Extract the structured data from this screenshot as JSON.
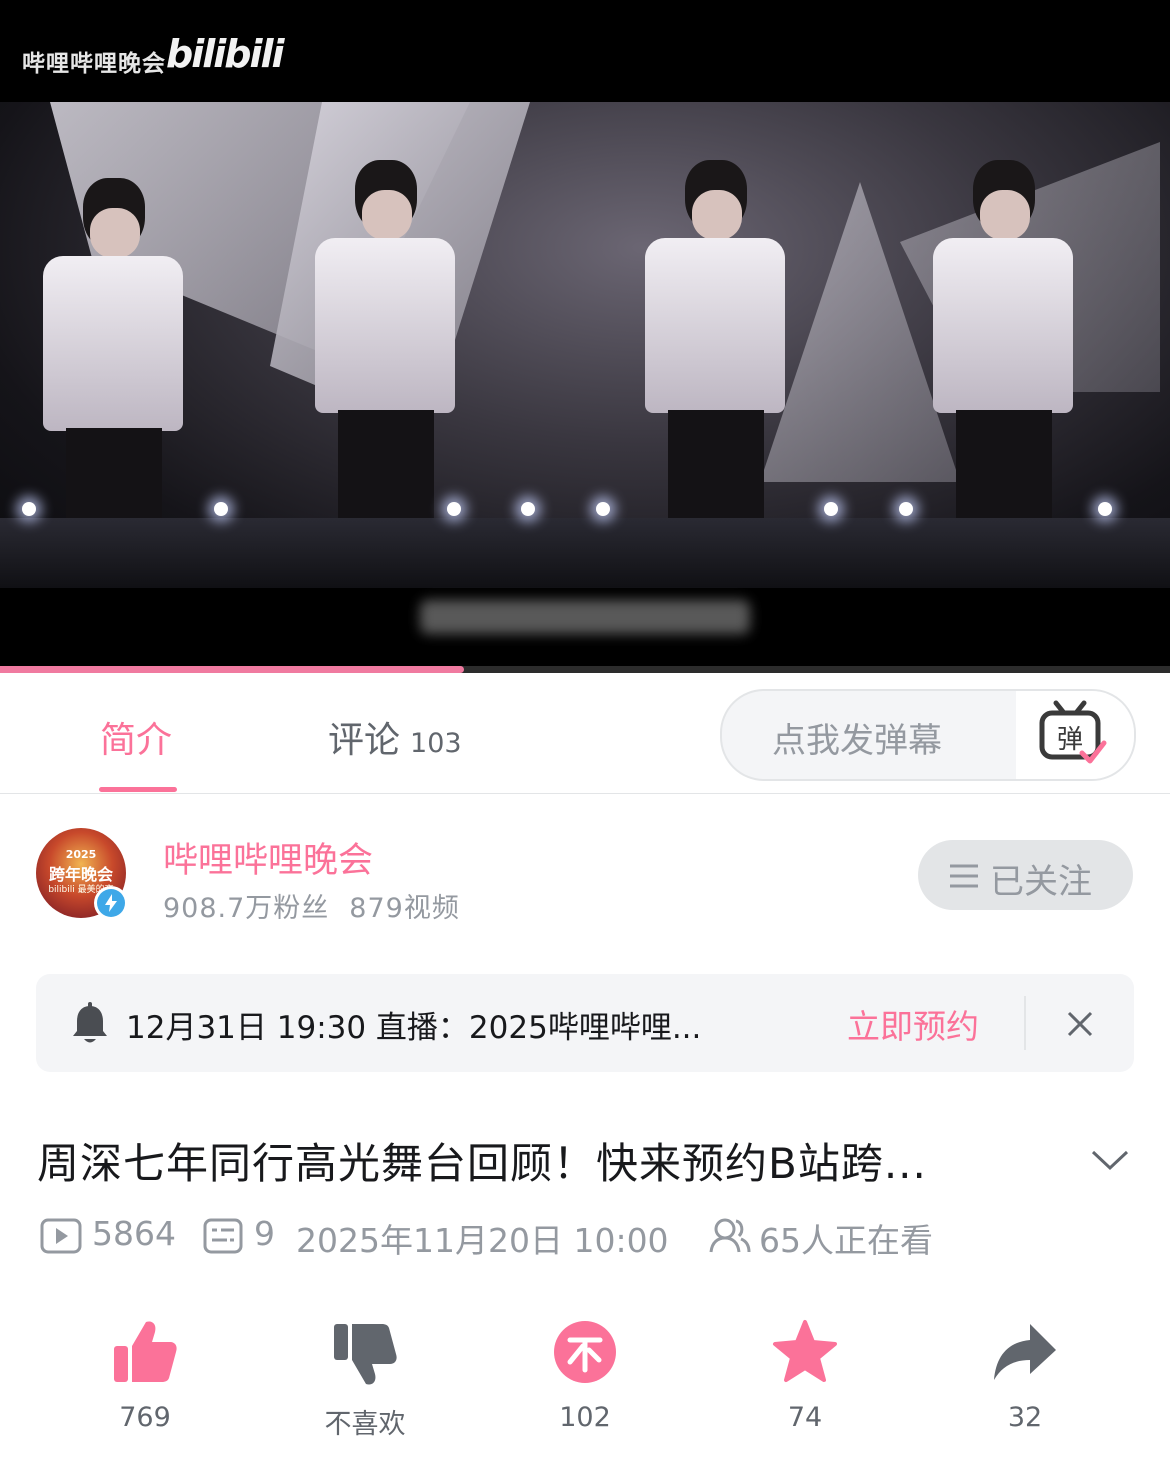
{
  "video": {
    "watermark": "哔哩哔哩晚会",
    "logo": "bilibili",
    "progress_fraction": 0.397
  },
  "tabs": {
    "intro": "简介",
    "comments": "评论",
    "comments_count": "103",
    "danmaku_placeholder": "点我发弹幕",
    "danmaku_icon_label": "弹"
  },
  "uploader": {
    "name": "哔哩哔哩晚会",
    "fans": "908.7万粉丝",
    "videos": "879视频",
    "follow_label": "已关注",
    "avatar_text_year": "2025",
    "avatar_text_main": "跨年晚会",
    "avatar_text_sub": "bilibili 最美的夜"
  },
  "reservation": {
    "text": "12月31日 19:30 直播：2025哔哩哔哩...",
    "cta": "立即预约"
  },
  "video_info": {
    "title": "周深七年同行高光舞台回顾！快来预约B站跨...",
    "views": "5864",
    "danmaku": "9",
    "date": "2025年11月20日 10:00",
    "watching": "65人正在看"
  },
  "actions": {
    "like": "769",
    "dislike": "不喜欢",
    "coin": "102",
    "favorite": "74",
    "share": "32"
  },
  "colors": {
    "accent": "#fb7299",
    "gray_text": "#9499a0",
    "dark_text": "#18191c",
    "progress": "#f07aa0"
  }
}
